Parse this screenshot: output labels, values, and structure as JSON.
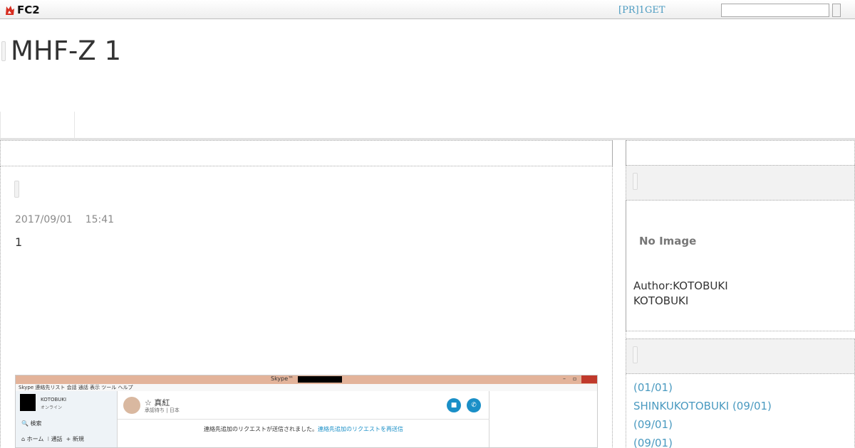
{
  "fc2_bar": {
    "logo_text": "FC2",
    "pr_link": "[PR]1GET",
    "search_value": ""
  },
  "blog": {
    "title": "MHF-Z 1"
  },
  "entry": {
    "date": "2017/09/01",
    "time": "15:41",
    "body": "1"
  },
  "screenshot": {
    "window_title": "Skype™",
    "menu": "Skype  連絡先リスト  会話  通話  表示  ツール  ヘルプ",
    "user_name": "KOTOBUKI",
    "user_status": "オンライン",
    "search_label": "検索",
    "nav_home": "ホーム",
    "nav_call": "通話",
    "nav_new": "新規",
    "contact_name": "☆ 真紅",
    "contact_sub": "承認待ち | 日本",
    "notice_text": "連絡先追加のリクエストが送信されました。",
    "notice_link": "連絡先追加のリクエストを再送信"
  },
  "sidebar": {
    "no_image": "No Image",
    "author_label": "Author:KOTOBUKI",
    "author_name": "KOTOBUKI",
    "archives": [
      " (01/01)",
      "SHINKUKOTOBUKI (09/01)",
      " (09/01)",
      " (09/01)"
    ]
  },
  "colors": {
    "link": "#4a9ac0",
    "text": "#333333",
    "muted": "#8a8a8a",
    "skype_blue": "#1a8fc7"
  }
}
